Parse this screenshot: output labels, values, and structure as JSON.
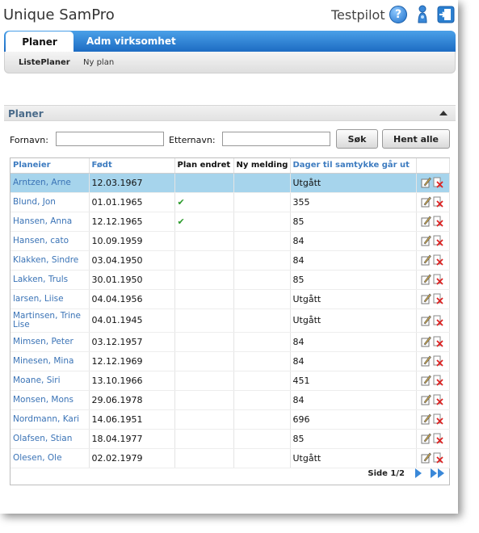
{
  "header": {
    "app_title": "Unique SamPro",
    "user_name": "Testpilot"
  },
  "icons": {
    "help": "help-icon",
    "user": "user-icon",
    "logout": "logout-icon"
  },
  "tabs": [
    {
      "label": "Planer"
    },
    {
      "label": "Adm virksomhet"
    }
  ],
  "subnav": {
    "items": [
      {
        "label": "ListePlaner"
      },
      {
        "label": "Ny plan"
      }
    ]
  },
  "panel": {
    "title": "Planer"
  },
  "search": {
    "first_name_label": "Fornavn:",
    "last_name_label": "Etternavn:",
    "first_name_value": "",
    "last_name_value": "",
    "search_button": "Søk",
    "fetch_all_button": "Hent alle"
  },
  "table": {
    "columns": [
      "Planeier",
      "Født",
      "Plan endret",
      "Ny melding",
      "Dager til samtykke går ut"
    ],
    "rows": [
      {
        "name": "Arntzen, Arne",
        "born": "12.03.1967",
        "plan_changed": false,
        "days": "Utgått",
        "selected": true
      },
      {
        "name": "Blund, Jon",
        "born": "01.01.1965",
        "plan_changed": true,
        "days": "355"
      },
      {
        "name": "Hansen, Anna",
        "born": "12.12.1965",
        "plan_changed": true,
        "days": "85"
      },
      {
        "name": "Hansen, cato",
        "born": "10.09.1959",
        "plan_changed": false,
        "days": "84"
      },
      {
        "name": "Klakken, Sindre",
        "born": "03.04.1950",
        "plan_changed": false,
        "days": "84"
      },
      {
        "name": "Lakken, Truls",
        "born": "30.01.1950",
        "plan_changed": false,
        "days": "85"
      },
      {
        "name": "larsen, Liise",
        "born": "04.04.1956",
        "plan_changed": false,
        "days": "Utgått"
      },
      {
        "name": "Martinsen, Trine Lise",
        "born": "04.01.1945",
        "plan_changed": false,
        "days": "Utgått"
      },
      {
        "name": "Mimsen, Peter",
        "born": "03.12.1957",
        "plan_changed": false,
        "days": "84"
      },
      {
        "name": "Minesen, Mina",
        "born": "12.12.1969",
        "plan_changed": false,
        "days": "84"
      },
      {
        "name": "Moane, Siri",
        "born": "13.10.1966",
        "plan_changed": false,
        "days": "451"
      },
      {
        "name": "Monsen, Mons",
        "born": "29.06.1978",
        "plan_changed": false,
        "days": "84"
      },
      {
        "name": "Nordmann, Kari",
        "born": "14.06.1951",
        "plan_changed": false,
        "days": "696"
      },
      {
        "name": "Olafsen, Stian",
        "born": "18.04.1977",
        "plan_changed": false,
        "days": "85"
      },
      {
        "name": "Olesen, Ole",
        "born": "02.02.1979",
        "plan_changed": false,
        "days": "Utgått"
      }
    ],
    "pager_text": "Side 1/2"
  },
  "colors": {
    "accent": "#1d6cc3",
    "link": "#3a73b6",
    "selected_row": "#a6d4ec",
    "check": "#2a9a2a"
  }
}
